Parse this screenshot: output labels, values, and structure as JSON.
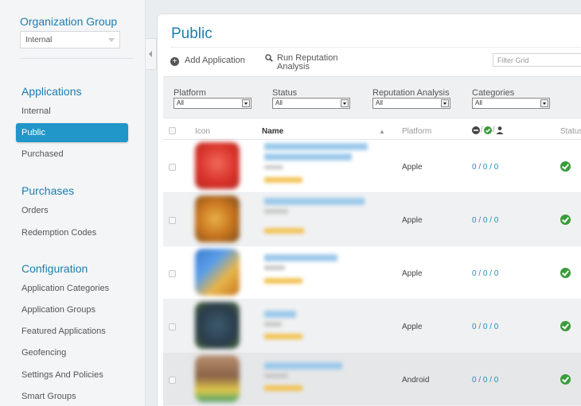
{
  "sidebar": {
    "org_group_title": "Organization Group",
    "org_group_value": "Internal",
    "sections": [
      {
        "title": "Applications",
        "items": [
          "Internal",
          "Public",
          "Purchased"
        ],
        "active": "Public"
      },
      {
        "title": "Purchases",
        "items": [
          "Orders",
          "Redemption Codes"
        ]
      },
      {
        "title": "Configuration",
        "items": [
          "Application Categories",
          "Application Groups",
          "Featured Applications",
          "Geofencing",
          "Settings And Policies",
          "Smart Groups"
        ]
      }
    ]
  },
  "main": {
    "title": "Public",
    "toolbar": {
      "add_label": "Add Application",
      "add_icon": "plus-circle-icon",
      "reputation_label": "Run Reputation Analysis",
      "reputation_icon": "search-icon",
      "filter_placeholder": "Filter Grid"
    },
    "filters": [
      {
        "label": "Platform",
        "value": "All"
      },
      {
        "label": "Status",
        "value": "All"
      },
      {
        "label": "Reputation Analysis",
        "value": "All"
      },
      {
        "label": "Categories",
        "value": "All"
      }
    ],
    "table": {
      "columns": {
        "icon": "Icon",
        "name": "Name",
        "platform": "Platform",
        "reputation_sep": "/",
        "status": "Status"
      },
      "reputation_icons": [
        "minus-circle-icon",
        "check-circle-icon",
        "user-icon"
      ],
      "sort_icon": "sort-up-icon",
      "rows": [
        {
          "platform": "Apple",
          "counts": "0 / 0 / 0",
          "status_icon": "check-circle-icon"
        },
        {
          "platform": "Apple",
          "counts": "0 / 0 / 0",
          "status_icon": "check-circle-icon"
        },
        {
          "platform": "Apple",
          "counts": "0 / 0 / 0",
          "status_icon": "check-circle-icon"
        },
        {
          "platform": "Apple",
          "counts": "0 / 0 / 0",
          "status_icon": "check-circle-icon"
        },
        {
          "platform": "Android",
          "counts": "0 / 0 / 0",
          "status_icon": "check-circle-icon"
        }
      ]
    }
  },
  "colors": {
    "accent": "#1b7db0",
    "active_nav": "#2196c9",
    "status_ok": "#3a9b3a",
    "link": "#2a8ab8"
  }
}
